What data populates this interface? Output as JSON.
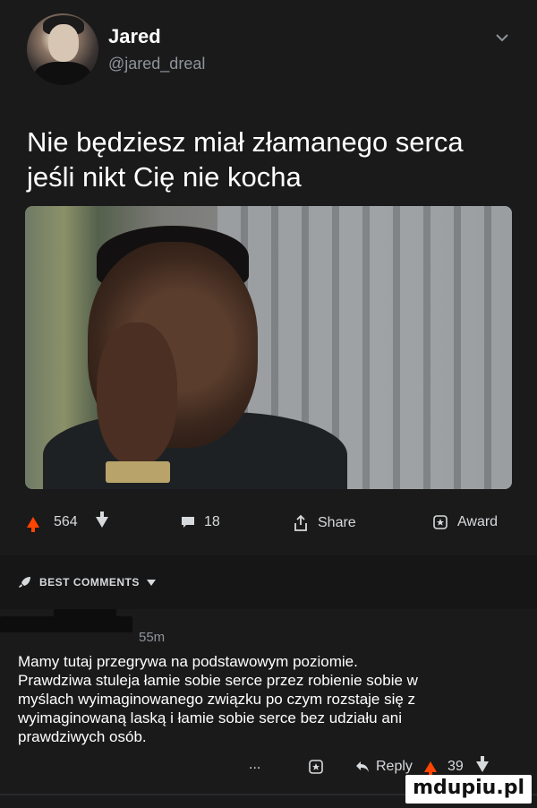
{
  "post": {
    "author": {
      "name": "Jared",
      "handle": "@jared_dreal"
    },
    "text": "Nie będziesz miał złamanego serca\njeśli nikt Cię nie kocha",
    "actions": {
      "score": "564",
      "comments": "18",
      "share": "Share",
      "award": "Award"
    }
  },
  "comments_section": {
    "header": "BEST COMMENTS",
    "comment": {
      "time": "55m",
      "body": "Mamy tutaj przegrywa na podstawowym poziomie.\nPrawdziwa stuleja łamie sobie serce przez robienie sobie w\nmyślach wyimaginowanego związku po czym rozstaje się z\nwyimaginowaną laską i łamie sobie serce bez udziału ani\nprawdziwych osób.",
      "more": "...",
      "reply": "Reply",
      "score": "39"
    }
  },
  "watermark": "mdupiu.pl",
  "colors": {
    "background": "#1a1a1b",
    "upvote": "#ff4500",
    "text": "#ffffff",
    "muted": "#8e9499"
  },
  "icons": [
    "chevron-down-icon",
    "upvote-icon",
    "downvote-icon",
    "comment-icon",
    "share-icon",
    "award-icon",
    "rocket-icon",
    "reply-icon"
  ]
}
